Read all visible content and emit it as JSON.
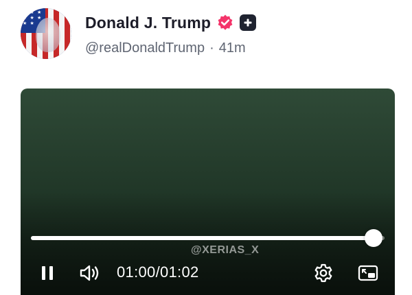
{
  "post": {
    "author": {
      "display_name": "Donald J. Trump",
      "handle": "@realDonaldTrump",
      "separator": "·",
      "timestamp": "41m",
      "avatar_icon": "avatar-image",
      "verified_icon": "verified-badge-icon",
      "verified_color": "#f4346a",
      "extra_badge_icon": "plus-badge-icon"
    },
    "video": {
      "watermark": "@XERIAS_X",
      "current_time": "01:00",
      "time_separator": "/",
      "duration": "01:02",
      "progress": 0.968,
      "play_state_icon": "pause-icon",
      "volume_icon": "volume-icon",
      "settings_icon": "settings-gear-icon",
      "pip_icon": "picture-in-picture-icon"
    }
  }
}
